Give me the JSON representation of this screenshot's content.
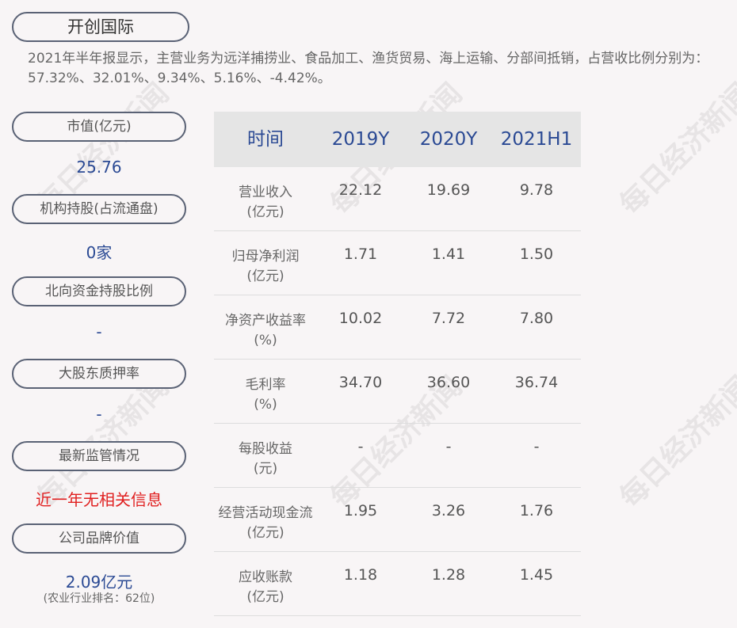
{
  "company": "开创国际",
  "description": "2021年半年报显示，主营业务为远洋捕捞业、食品加工、渔货贸易、海上运输、分部间抵销，占营收比例分别为：57.32%、32.01%、9.34%、5.16%、-4.42%。",
  "left": [
    {
      "label": "市值(亿元)",
      "value": "25.76"
    },
    {
      "label": "机构持股(占流通盘)",
      "value": "0家"
    },
    {
      "label": "北向资金持股比例",
      "value": "-"
    },
    {
      "label": "大股东质押率",
      "value": "-"
    },
    {
      "label": "最新监管情况",
      "value": "近一年无相关信息"
    },
    {
      "label": "公司品牌价值",
      "value": "2.09亿元",
      "note": "(农业行业排名：62位)"
    }
  ],
  "table": {
    "headers": [
      "时间",
      "2019Y",
      "2020Y",
      "2021H1"
    ],
    "rows": [
      {
        "l1": "营业收入",
        "l2": "(亿元)",
        "v": [
          "22.12",
          "19.69",
          "9.78"
        ]
      },
      {
        "l1": "归母净利润",
        "l2": "(亿元)",
        "v": [
          "1.71",
          "1.41",
          "1.50"
        ]
      },
      {
        "l1": "净资产收益率",
        "l2": "(%)",
        "v": [
          "10.02",
          "7.72",
          "7.80"
        ]
      },
      {
        "l1": "毛利率",
        "l2": "(%)",
        "v": [
          "34.70",
          "36.60",
          "36.74"
        ]
      },
      {
        "l1": "每股收益",
        "l2": "(元)",
        "v": [
          "-",
          "-",
          "-"
        ]
      },
      {
        "l1": "经营活动现金流",
        "l2": "(亿元)",
        "v": [
          "1.95",
          "3.26",
          "1.76"
        ]
      },
      {
        "l1": "应收账款",
        "l2": "(亿元)",
        "v": [
          "1.18",
          "1.28",
          "1.45"
        ]
      }
    ]
  },
  "watermark": "每日经济新闻",
  "colors": {
    "blue": "#2b4a94",
    "red": "#e02020"
  }
}
